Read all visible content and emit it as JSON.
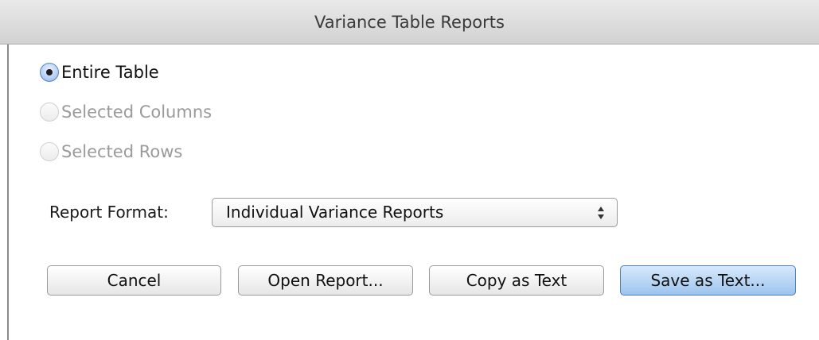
{
  "window": {
    "title": "Variance Table Reports"
  },
  "scope": {
    "options": [
      {
        "label": "Entire Table",
        "selected": true,
        "enabled": true
      },
      {
        "label": "Selected Columns",
        "selected": false,
        "enabled": false
      },
      {
        "label": "Selected Rows",
        "selected": false,
        "enabled": false
      }
    ]
  },
  "format": {
    "label": "Report Format:",
    "selected_value": "Individual Variance Reports",
    "icon": "updown-arrows-icon"
  },
  "buttons": {
    "cancel": "Cancel",
    "open_report": "Open Report...",
    "copy_text": "Copy as Text",
    "save_text": "Save as Text..."
  },
  "colors": {
    "default_button": "#9cc4ee",
    "selected_radio": "#8db3e8"
  }
}
